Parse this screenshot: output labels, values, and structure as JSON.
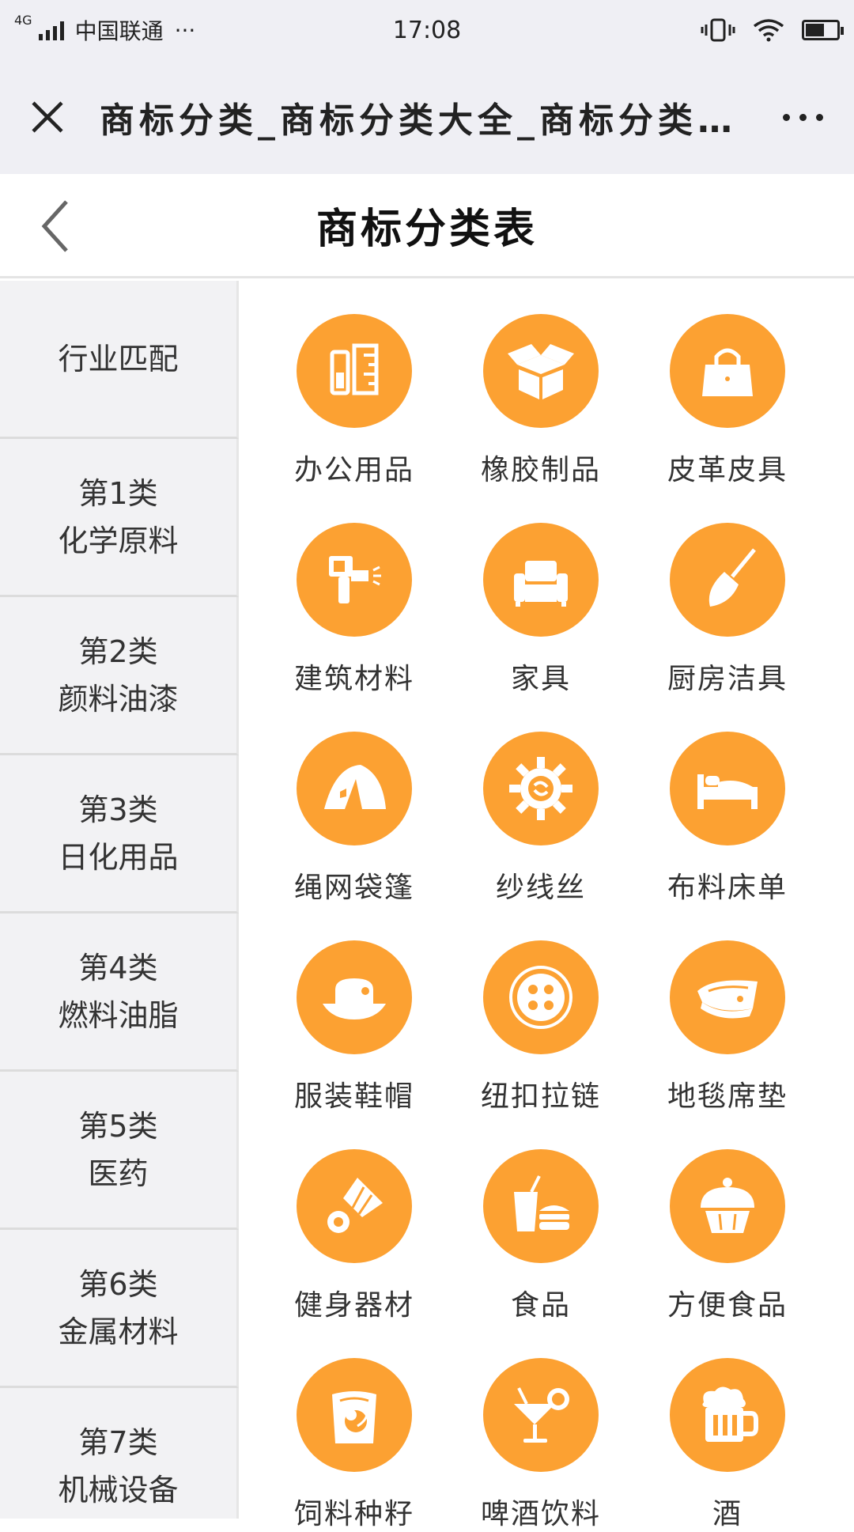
{
  "status_bar": {
    "network": "4G",
    "carrier": "中国联通",
    "more": "···",
    "time": "17:08",
    "battery_fraction": 0.6
  },
  "nav": {
    "title": "商标分类_商标分类大全_商标分类表…"
  },
  "page": {
    "title": "商标分类表"
  },
  "sidebar": {
    "items": [
      {
        "line1": "行业匹配",
        "line2": "",
        "active": true
      },
      {
        "line1": "第1类",
        "line2": "化学原料",
        "active": false
      },
      {
        "line1": "第2类",
        "line2": "颜料油漆",
        "active": false
      },
      {
        "line1": "第3类",
        "line2": "日化用品",
        "active": false
      },
      {
        "line1": "第4类",
        "line2": "燃料油脂",
        "active": false
      },
      {
        "line1": "第5类",
        "line2": "医药",
        "active": false
      },
      {
        "line1": "第6类",
        "line2": "金属材料",
        "active": false
      },
      {
        "line1": "第7类",
        "line2": "机械设备",
        "active": false
      }
    ]
  },
  "categories": [
    {
      "label": "办公用品",
      "icon": "ruler-pencil-icon"
    },
    {
      "label": "橡胶制品",
      "icon": "open-box-icon"
    },
    {
      "label": "皮革皮具",
      "icon": "handbag-icon"
    },
    {
      "label": "建筑材料",
      "icon": "spray-gun-icon"
    },
    {
      "label": "家具",
      "icon": "sofa-icon"
    },
    {
      "label": "厨房洁具",
      "icon": "broom-icon"
    },
    {
      "label": "绳网袋篷",
      "icon": "tent-icon"
    },
    {
      "label": "纱线丝",
      "icon": "gear-icon"
    },
    {
      "label": "布料床单",
      "icon": "bed-icon"
    },
    {
      "label": "服装鞋帽",
      "icon": "hat-icon"
    },
    {
      "label": "纽扣拉链",
      "icon": "button-icon"
    },
    {
      "label": "地毯席垫",
      "icon": "carpet-icon"
    },
    {
      "label": "健身器材",
      "icon": "shuttlecock-icon"
    },
    {
      "label": "食品",
      "icon": "drink-burger-icon"
    },
    {
      "label": "方便食品",
      "icon": "cupcake-icon"
    },
    {
      "label": "饲料种籽",
      "icon": "feed-bag-icon"
    },
    {
      "label": "啤酒饮料",
      "icon": "cocktail-icon"
    },
    {
      "label": "酒",
      "icon": "beer-mug-icon"
    }
  ],
  "colors": {
    "accent": "#fca132",
    "active_text": "#d9473a",
    "active_bar": "#ef3b2c",
    "sidebar_bg": "#f2f2f4",
    "navbar_bg": "#efeff4"
  }
}
